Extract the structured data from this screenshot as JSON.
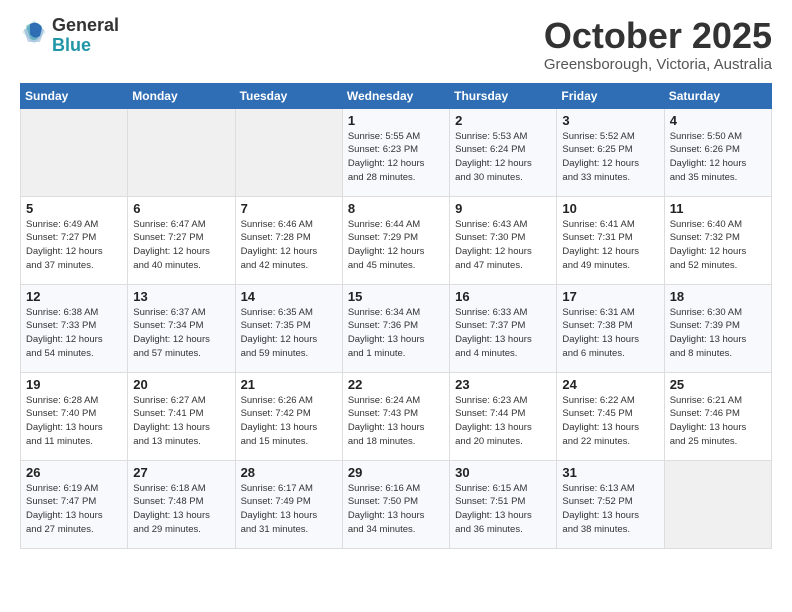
{
  "logo": {
    "general": "General",
    "blue": "Blue"
  },
  "title": {
    "month": "October 2025",
    "location": "Greensborough, Victoria, Australia"
  },
  "headers": [
    "Sunday",
    "Monday",
    "Tuesday",
    "Wednesday",
    "Thursday",
    "Friday",
    "Saturday"
  ],
  "weeks": [
    [
      {
        "day": "",
        "info": ""
      },
      {
        "day": "",
        "info": ""
      },
      {
        "day": "",
        "info": ""
      },
      {
        "day": "1",
        "info": "Sunrise: 5:55 AM\nSunset: 6:23 PM\nDaylight: 12 hours\nand 28 minutes."
      },
      {
        "day": "2",
        "info": "Sunrise: 5:53 AM\nSunset: 6:24 PM\nDaylight: 12 hours\nand 30 minutes."
      },
      {
        "day": "3",
        "info": "Sunrise: 5:52 AM\nSunset: 6:25 PM\nDaylight: 12 hours\nand 33 minutes."
      },
      {
        "day": "4",
        "info": "Sunrise: 5:50 AM\nSunset: 6:26 PM\nDaylight: 12 hours\nand 35 minutes."
      }
    ],
    [
      {
        "day": "5",
        "info": "Sunrise: 6:49 AM\nSunset: 7:27 PM\nDaylight: 12 hours\nand 37 minutes."
      },
      {
        "day": "6",
        "info": "Sunrise: 6:47 AM\nSunset: 7:27 PM\nDaylight: 12 hours\nand 40 minutes."
      },
      {
        "day": "7",
        "info": "Sunrise: 6:46 AM\nSunset: 7:28 PM\nDaylight: 12 hours\nand 42 minutes."
      },
      {
        "day": "8",
        "info": "Sunrise: 6:44 AM\nSunset: 7:29 PM\nDaylight: 12 hours\nand 45 minutes."
      },
      {
        "day": "9",
        "info": "Sunrise: 6:43 AM\nSunset: 7:30 PM\nDaylight: 12 hours\nand 47 minutes."
      },
      {
        "day": "10",
        "info": "Sunrise: 6:41 AM\nSunset: 7:31 PM\nDaylight: 12 hours\nand 49 minutes."
      },
      {
        "day": "11",
        "info": "Sunrise: 6:40 AM\nSunset: 7:32 PM\nDaylight: 12 hours\nand 52 minutes."
      }
    ],
    [
      {
        "day": "12",
        "info": "Sunrise: 6:38 AM\nSunset: 7:33 PM\nDaylight: 12 hours\nand 54 minutes."
      },
      {
        "day": "13",
        "info": "Sunrise: 6:37 AM\nSunset: 7:34 PM\nDaylight: 12 hours\nand 57 minutes."
      },
      {
        "day": "14",
        "info": "Sunrise: 6:35 AM\nSunset: 7:35 PM\nDaylight: 12 hours\nand 59 minutes."
      },
      {
        "day": "15",
        "info": "Sunrise: 6:34 AM\nSunset: 7:36 PM\nDaylight: 13 hours\nand 1 minute."
      },
      {
        "day": "16",
        "info": "Sunrise: 6:33 AM\nSunset: 7:37 PM\nDaylight: 13 hours\nand 4 minutes."
      },
      {
        "day": "17",
        "info": "Sunrise: 6:31 AM\nSunset: 7:38 PM\nDaylight: 13 hours\nand 6 minutes."
      },
      {
        "day": "18",
        "info": "Sunrise: 6:30 AM\nSunset: 7:39 PM\nDaylight: 13 hours\nand 8 minutes."
      }
    ],
    [
      {
        "day": "19",
        "info": "Sunrise: 6:28 AM\nSunset: 7:40 PM\nDaylight: 13 hours\nand 11 minutes."
      },
      {
        "day": "20",
        "info": "Sunrise: 6:27 AM\nSunset: 7:41 PM\nDaylight: 13 hours\nand 13 minutes."
      },
      {
        "day": "21",
        "info": "Sunrise: 6:26 AM\nSunset: 7:42 PM\nDaylight: 13 hours\nand 15 minutes."
      },
      {
        "day": "22",
        "info": "Sunrise: 6:24 AM\nSunset: 7:43 PM\nDaylight: 13 hours\nand 18 minutes."
      },
      {
        "day": "23",
        "info": "Sunrise: 6:23 AM\nSunset: 7:44 PM\nDaylight: 13 hours\nand 20 minutes."
      },
      {
        "day": "24",
        "info": "Sunrise: 6:22 AM\nSunset: 7:45 PM\nDaylight: 13 hours\nand 22 minutes."
      },
      {
        "day": "25",
        "info": "Sunrise: 6:21 AM\nSunset: 7:46 PM\nDaylight: 13 hours\nand 25 minutes."
      }
    ],
    [
      {
        "day": "26",
        "info": "Sunrise: 6:19 AM\nSunset: 7:47 PM\nDaylight: 13 hours\nand 27 minutes."
      },
      {
        "day": "27",
        "info": "Sunrise: 6:18 AM\nSunset: 7:48 PM\nDaylight: 13 hours\nand 29 minutes."
      },
      {
        "day": "28",
        "info": "Sunrise: 6:17 AM\nSunset: 7:49 PM\nDaylight: 13 hours\nand 31 minutes."
      },
      {
        "day": "29",
        "info": "Sunrise: 6:16 AM\nSunset: 7:50 PM\nDaylight: 13 hours\nand 34 minutes."
      },
      {
        "day": "30",
        "info": "Sunrise: 6:15 AM\nSunset: 7:51 PM\nDaylight: 13 hours\nand 36 minutes."
      },
      {
        "day": "31",
        "info": "Sunrise: 6:13 AM\nSunset: 7:52 PM\nDaylight: 13 hours\nand 38 minutes."
      },
      {
        "day": "",
        "info": ""
      }
    ]
  ]
}
